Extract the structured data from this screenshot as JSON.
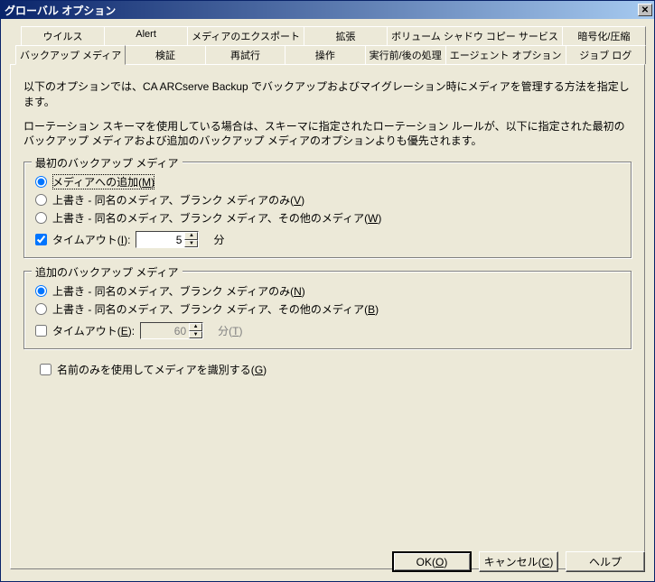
{
  "window": {
    "title": "グローバル オプション"
  },
  "tabs": {
    "row1": [
      "ウイルス",
      "Alert",
      "メディアのエクスポート",
      "拡張",
      "ボリューム シャドウ コピー サービス",
      "暗号化/圧縮"
    ],
    "row2": [
      "バックアップ メディア",
      "検証",
      "再試行",
      "操作",
      "実行前/後の処理",
      "エージェント オプション",
      "ジョブ ログ"
    ],
    "active": "バックアップ メディア"
  },
  "desc1": "以下のオプションでは、CA ARCserve Backup でバックアップおよびマイグレーション時にメディアを管理する方法を指定します。",
  "desc2": "ローテーション スキーマを使用している場合は、スキーマに指定されたローテーション ルールが、以下に指定された最初のバックアップ メディアおよび追加のバックアップ メディアのオプションよりも優先されます。",
  "group1": {
    "legend": "最初のバックアップ メディア",
    "opt1": "メディアへの追加(M)",
    "opt2": "上書き - 同名のメディア、ブランク メディアのみ(V)",
    "opt3": "上書き - 同名のメディア、ブランク メディア、その他のメディア(W)",
    "timeout_label": "タイムアウト(I):",
    "timeout_value": "5",
    "unit": "分"
  },
  "group2": {
    "legend": "追加のバックアップ メディア",
    "opt1": "上書き - 同名のメディア、ブランク メディアのみ(N)",
    "opt2": "上書き - 同名のメディア、ブランク メディア、その他のメディア(B)",
    "timeout_label": "タイムアウト(E):",
    "timeout_value": "60",
    "unit": "分(T)"
  },
  "nameonly": "名前のみを使用してメディアを識別する(G)",
  "buttons": {
    "ok": "OK(O)",
    "cancel": "キャンセル(C)",
    "help": "ヘルプ"
  }
}
